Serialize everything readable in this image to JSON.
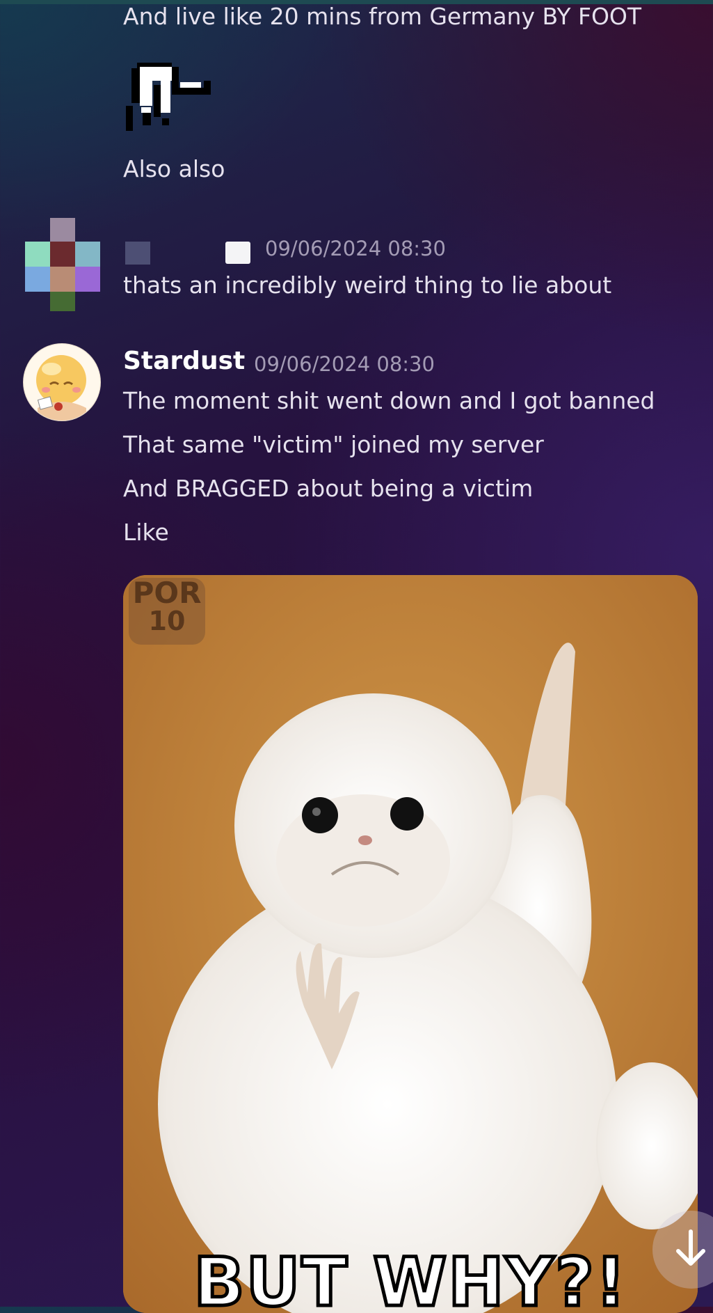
{
  "messages": {
    "prev_line_1": "And live like 20 mins from Germany BY FOOT",
    "prev_line_2": "Also also",
    "user2": {
      "timestamp": "09/06/2024 08:30",
      "text": "thats an incredibly weird thing to lie about"
    },
    "stardust": {
      "name": "Stardust",
      "timestamp": "09/06/2024 08:30",
      "lines": [
        "The moment shit went down and I got banned",
        "That same \"victim\" joined my server",
        "And BRAGGED about being a victim",
        "Like"
      ]
    }
  },
  "attachment": {
    "watermark_line1": "POR",
    "watermark_line2": "10",
    "caption": "BUT WHY?!"
  },
  "icons": {
    "sticker": "pixel-sticker-icon",
    "scroll": "arrow-down-icon"
  },
  "colors": {
    "name": "#ffffff",
    "text": "#e6e2ee",
    "timestamp": "#a49cb5"
  }
}
